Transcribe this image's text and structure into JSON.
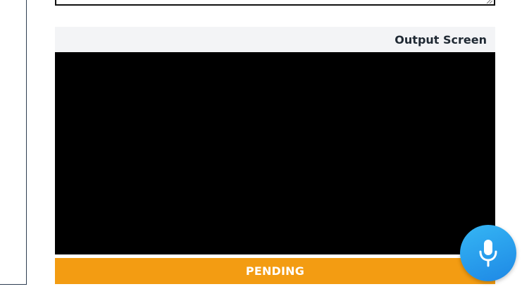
{
  "output": {
    "title": "Output Screen"
  },
  "status": {
    "label": "PENDING"
  },
  "colors": {
    "status_bar": "#f39c12",
    "mic_button": "#2196f3",
    "output_screen": "#000000",
    "header_bg": "#f3f4f6"
  },
  "icons": {
    "mic": "microphone-icon",
    "resize": "resize-handle-icon"
  }
}
